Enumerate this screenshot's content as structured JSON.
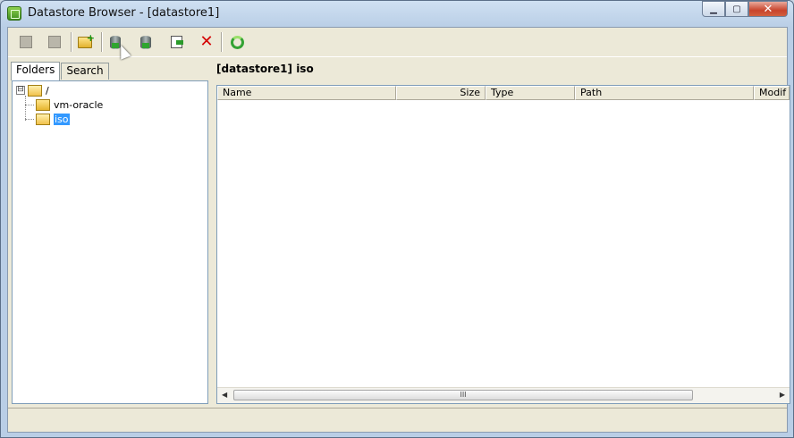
{
  "window": {
    "title": "Datastore Browser - [datastore1]"
  },
  "toolbar": {
    "buttons": [
      {
        "icon": "copy-icon",
        "enabled": false
      },
      {
        "icon": "paste-icon",
        "enabled": false
      },
      {
        "icon": "new-folder-icon",
        "enabled": true
      },
      {
        "icon": "upload-icon",
        "enabled": true
      },
      {
        "icon": "download-icon",
        "enabled": true
      },
      {
        "icon": "move-icon",
        "enabled": true
      },
      {
        "icon": "delete-icon",
        "enabled": true
      },
      {
        "icon": "refresh-icon",
        "enabled": true
      }
    ]
  },
  "tabs": [
    {
      "label": "Folders",
      "active": true
    },
    {
      "label": "Search",
      "active": false
    }
  ],
  "tree": {
    "root": {
      "label": "/",
      "expander": "⊟"
    },
    "children": [
      {
        "label": "vm-oracle",
        "selected": false
      },
      {
        "label": "iso",
        "selected": true
      }
    ]
  },
  "path_label": "[datastore1] iso",
  "list": {
    "columns": [
      "Name",
      "Size",
      "Type",
      "Path",
      "Modif"
    ],
    "rows": [],
    "scroll_thumb": "III"
  },
  "colors": {
    "selection": "#3399ff",
    "delete": "#d40000",
    "accent": "#34a334"
  }
}
